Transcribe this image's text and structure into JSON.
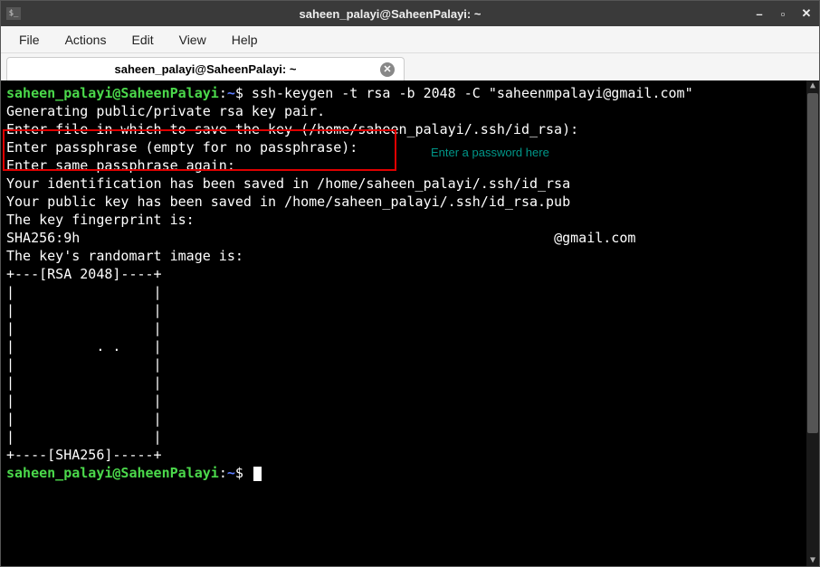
{
  "titlebar": {
    "title": "saheen_palayi@SaheenPalayi: ~"
  },
  "menubar": {
    "items": [
      "File",
      "Actions",
      "Edit",
      "View",
      "Help"
    ]
  },
  "tab": {
    "label": "saheen_palayi@SaheenPalayi: ~"
  },
  "annotation": {
    "text": "Enter a password here"
  },
  "prompt": {
    "user_host": "saheen_palayi@SaheenPalayi",
    "colon": ":",
    "path": "~",
    "dollar": "$"
  },
  "terminal": {
    "command": " ssh-keygen -t rsa -b 2048 -C \"saheenmpalayi@gmail.com\"",
    "line2": "Generating public/private rsa key pair.",
    "line3": "Enter file in which to save the key (/home/saheen_palayi/.ssh/id_rsa):",
    "line4": "Enter passphrase (empty for no passphrase):",
    "line5": "Enter same passphrase again:",
    "line6": "Your identification has been saved in /home/saheen_palayi/.ssh/id_rsa",
    "line7": "Your public key has been saved in /home/saheen_palayi/.ssh/id_rsa.pub",
    "line8": "The key fingerprint is:",
    "line9_prefix": "SHA256:9h",
    "line9_suffix": "@gmail.com",
    "line10": "The key's randomart image is:",
    "art": [
      "+---[RSA 2048]----+",
      "|                 |",
      "|                 |",
      "|                 |",
      "|          . .    |",
      "|                 |",
      "|                 |",
      "|                 |",
      "|                 |",
      "|                 |",
      "+----[SHA256]-----+"
    ]
  }
}
